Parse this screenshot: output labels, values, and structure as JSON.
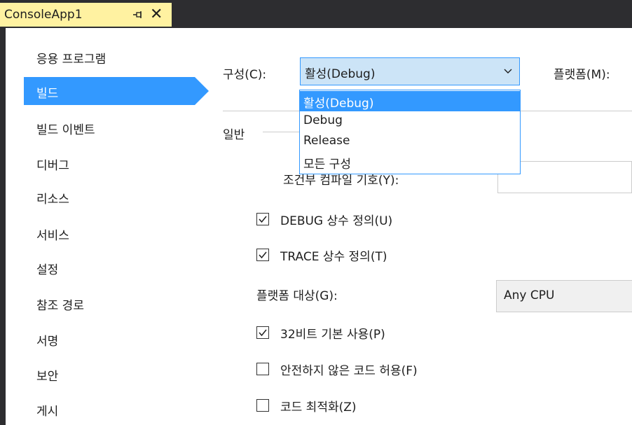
{
  "document_tab": {
    "title": "ConsoleApp1",
    "pin_icon": "pin-icon",
    "close_icon": "close-icon"
  },
  "sidebar": {
    "items": [
      {
        "label": "응용 프로그램",
        "selected": false
      },
      {
        "label": "빌드",
        "selected": true
      },
      {
        "label": "빌드 이벤트",
        "selected": false
      },
      {
        "label": "디버그",
        "selected": false
      },
      {
        "label": "리소스",
        "selected": false
      },
      {
        "label": "서비스",
        "selected": false
      },
      {
        "label": "설정",
        "selected": false
      },
      {
        "label": "참조 경로",
        "selected": false
      },
      {
        "label": "서명",
        "selected": false
      },
      {
        "label": "보안",
        "selected": false
      },
      {
        "label": "게시",
        "selected": false
      }
    ],
    "selected_color": "#3399ff"
  },
  "config": {
    "label": "구성(C):",
    "value": "활성(Debug)",
    "options": [
      "활성(Debug)",
      "Debug",
      "Release",
      "모든 구성"
    ],
    "selected_option": "활성(Debug)"
  },
  "platform": {
    "label": "플랫폼(M):"
  },
  "general_section": {
    "label": "일반"
  },
  "conditional_symbols": {
    "label": "조건부 컴파일 기호(Y):",
    "value": ""
  },
  "define_debug": {
    "label": "DEBUG 상수 정의(U)",
    "checked": true
  },
  "define_trace": {
    "label": "TRACE 상수 정의(T)",
    "checked": true
  },
  "platform_target": {
    "label": "플랫폼 대상(G):",
    "value": "Any CPU"
  },
  "prefer_32bit": {
    "label": "32비트 기본 사용(P)",
    "checked": true
  },
  "allow_unsafe": {
    "label": "안전하지 않은 코드 허용(F)",
    "checked": false
  },
  "optimize": {
    "label": "코드 최적화(Z)",
    "checked": false
  },
  "colors": {
    "title_bar": "#2d2d30",
    "active_tab": "#fff2a1",
    "accent": "#3399ff",
    "combo_bg": "#cce4f7"
  }
}
